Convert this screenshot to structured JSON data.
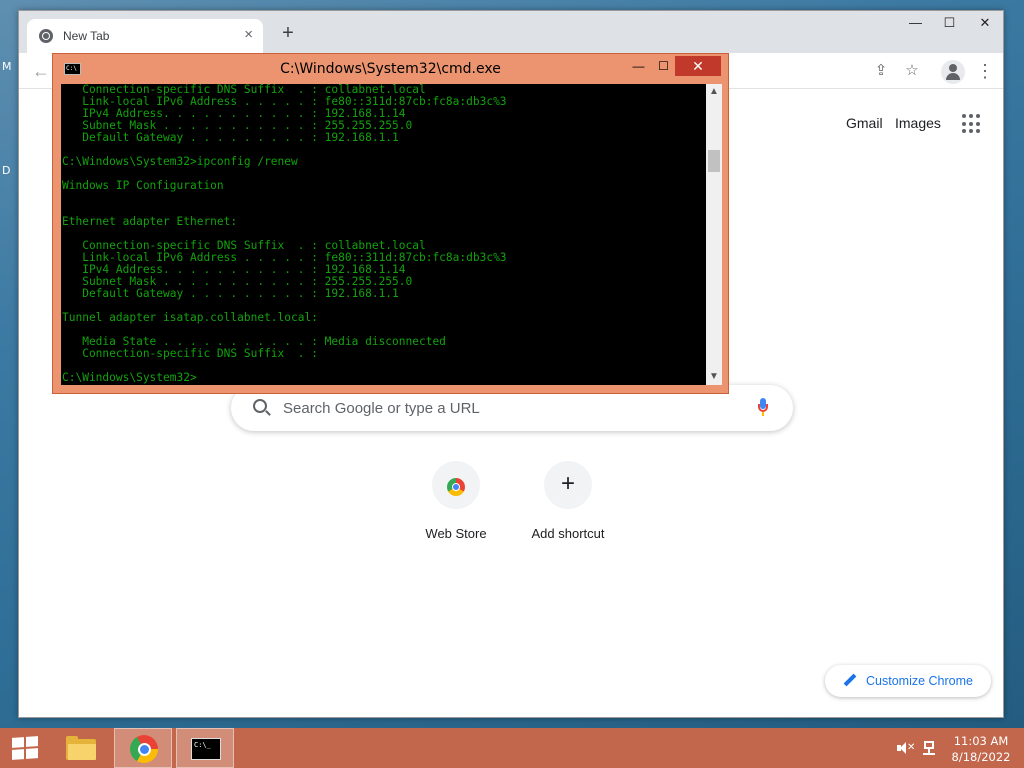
{
  "desktop": {
    "letters": [
      "M",
      "D"
    ]
  },
  "chrome": {
    "tab_title": "New Tab",
    "tab_close": "×",
    "new_tab": "+",
    "window_controls": {
      "minimize": "—",
      "maximize": "☐",
      "close": "✕"
    },
    "toolbar": {
      "back": "←",
      "share": "⇪",
      "bookmark": "☆",
      "menu": "⋮"
    },
    "links": {
      "gmail": "Gmail",
      "images": "Images"
    },
    "search": {
      "placeholder": "Search Google or type a URL"
    },
    "shortcuts": [
      {
        "label": "Web Store"
      },
      {
        "label": "Add shortcut",
        "symbol": "+"
      }
    ],
    "customize_label": "Customize Chrome"
  },
  "cmd": {
    "title": "C:\\Windows\\System32\\cmd.exe",
    "controls": {
      "minimize": "—",
      "maximize": "☐",
      "close": "✕"
    },
    "scroll_up": "▲",
    "scroll_down": "▼",
    "text_color": "#13a10e",
    "lines": [
      "   Connection-specific DNS Suffix  . : collabnet.local",
      "   Link-local IPv6 Address . . . . . : fe80::311d:87cb:fc8a:db3c%3",
      "   IPv4 Address. . . . . . . . . . . : 192.168.1.14",
      "   Subnet Mask . . . . . . . . . . . : 255.255.255.0",
      "   Default Gateway . . . . . . . . . : 192.168.1.1",
      "",
      "C:\\Windows\\System32>ipconfig /renew",
      "",
      "Windows IP Configuration",
      "",
      "",
      "Ethernet adapter Ethernet:",
      "",
      "   Connection-specific DNS Suffix  . : collabnet.local",
      "   Link-local IPv6 Address . . . . . : fe80::311d:87cb:fc8a:db3c%3",
      "   IPv4 Address. . . . . . . . . . . : 192.168.1.14",
      "   Subnet Mask . . . . . . . . . . . : 255.255.255.0",
      "   Default Gateway . . . . . . . . . : 192.168.1.1",
      "",
      "Tunnel adapter isatap.collabnet.local:",
      "",
      "   Media State . . . . . . . . . . . : Media disconnected",
      "   Connection-specific DNS Suffix  . :",
      "",
      "C:\\Windows\\System32>"
    ]
  },
  "taskbar": {
    "color": "#c2674b",
    "apps": [
      "file-explorer",
      "google-chrome",
      "command-prompt"
    ],
    "volume_mute": "✕",
    "clock": {
      "time": "11:03 AM",
      "date": "8/18/2022"
    }
  }
}
